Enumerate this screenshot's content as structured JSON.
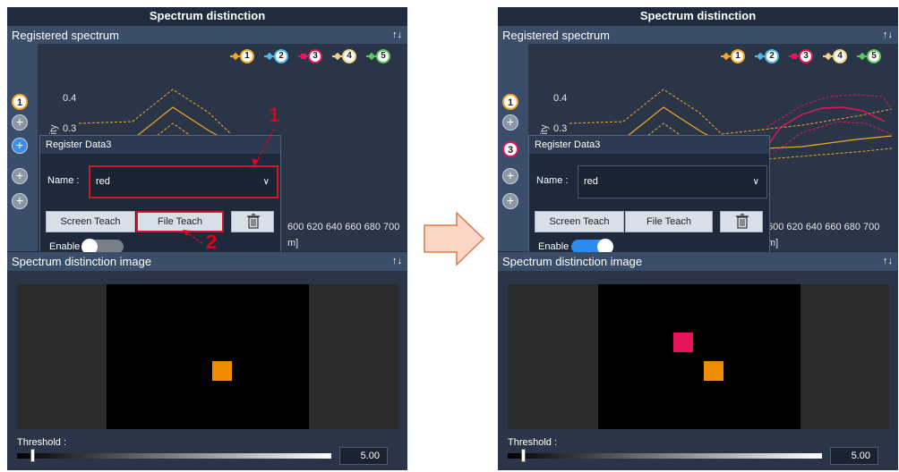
{
  "title": "Spectrum distinction",
  "registered_label": "Registered spectrum",
  "image_label": "Spectrum distinction image",
  "legend": [
    "1",
    "2",
    "3",
    "4",
    "5"
  ],
  "colors": {
    "s1": "#f5a623",
    "s2": "#4fb7e8",
    "s3": "#e8145a",
    "s4": "#f0d28a",
    "s5": "#5ac85a",
    "accent_red": "#d0162a"
  },
  "y_axis_label_fragment": "sity",
  "y_ticks": [
    "0.4",
    "0.3"
  ],
  "x_ticks": "600 620 640 660 680 700",
  "x_unit_fragment": "m]",
  "dialog": {
    "title": "Register Data3",
    "name_label": "Name :",
    "name_value": "red",
    "screen_teach": "Screen Teach",
    "file_teach": "File Teach",
    "enable": "Enable"
  },
  "threshold_label": "Threshold :",
  "threshold_value": "5.00",
  "annotations": [
    "1",
    "2"
  ],
  "left_slots": [
    "1",
    "+",
    "+",
    "+",
    "+"
  ],
  "right_slots": [
    "1",
    "+",
    "3",
    "+",
    "+"
  ],
  "left_enable": false,
  "right_enable": true,
  "threshold_level": 0.04,
  "icons": [
    "collapse-icon",
    "chevron-down-icon",
    "trash-icon",
    "right-arrow-icon"
  ]
}
